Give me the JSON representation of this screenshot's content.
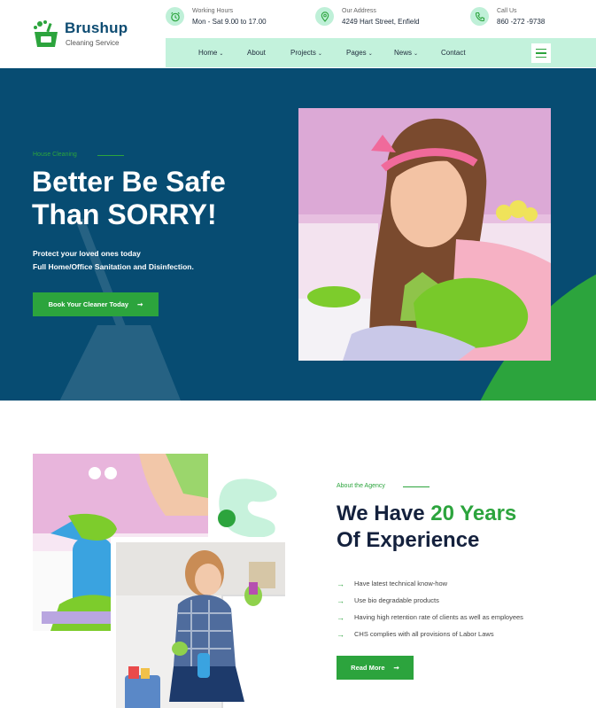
{
  "brand": {
    "name": "Brushup",
    "tagline": "Cleaning Service"
  },
  "topbar": {
    "hours": {
      "label": "Working Hours",
      "value": "Mon - Sat 9.00 to 17.00",
      "icon": "alarm-clock-icon"
    },
    "address": {
      "label": "Our Address",
      "value": "4249 Hart Street, Enfield",
      "icon": "map-pin-icon"
    },
    "phone": {
      "label": "Call Us",
      "value": "860 -272 -9738",
      "icon": "phone-icon"
    }
  },
  "nav": {
    "items": [
      {
        "label": "Home",
        "dropdown": true
      },
      {
        "label": "About",
        "dropdown": false
      },
      {
        "label": "Projects",
        "dropdown": true
      },
      {
        "label": "Pages",
        "dropdown": true
      },
      {
        "label": "News",
        "dropdown": true
      },
      {
        "label": "Contact",
        "dropdown": false
      }
    ],
    "chevron": "⌄"
  },
  "hero": {
    "eyebrow": "House Cleaning",
    "title_line1": "Better Be Safe",
    "title_line2": "Than SORRY!",
    "desc_line1": "Protect your loved ones today",
    "desc_line2": "Full Home/Office Sanitation and Disinfection.",
    "cta": "Book Your Cleaner Today",
    "cta_arrow": "➞"
  },
  "about": {
    "eyebrow": "About the Agency",
    "title_prefix": "We Have ",
    "title_highlight": "20 Years",
    "title_line2": "Of Experience",
    "list": [
      "Have latest technical know-how",
      "Use bio degradable products",
      "Having high retention rate of clients as well as employees",
      "CHS complies with all provisions of Labor Laws"
    ],
    "list_arrow": "→",
    "cta": "Read More",
    "cta_arrow": "➞"
  },
  "colors": {
    "brand_green": "#2ca43d",
    "hero_blue": "#074c72",
    "nav_mint": "#c3f2dc",
    "title_navy": "#14213d"
  }
}
